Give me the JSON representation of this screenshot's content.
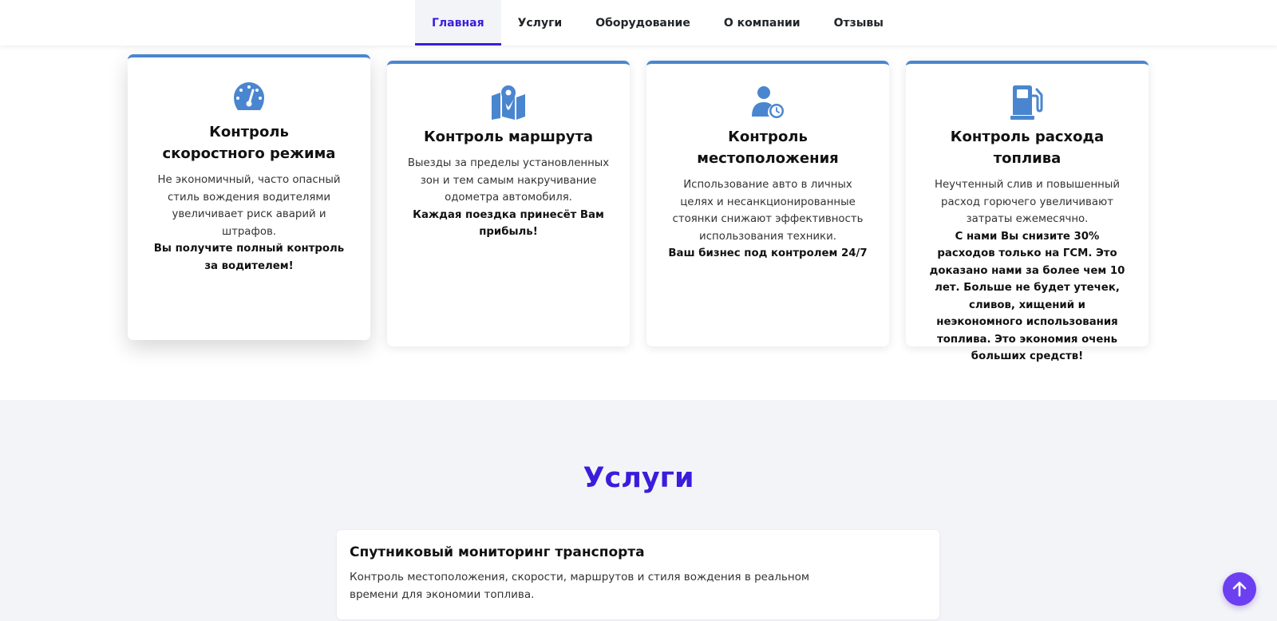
{
  "nav": {
    "items": [
      {
        "label": "Главная",
        "active": true
      },
      {
        "label": "Услуги",
        "active": false
      },
      {
        "label": "Оборудование",
        "active": false
      },
      {
        "label": "О компании",
        "active": false
      },
      {
        "label": "Отзывы",
        "active": false
      }
    ]
  },
  "features": [
    {
      "icon": "speedometer-icon",
      "title": "Контроль скоростного режима",
      "text": "Не экономичный, часто опасный стиль вождения водителями увеличивает риск аварий и штрафов.",
      "strong": "Вы получите полный контроль за водителем!"
    },
    {
      "icon": "map-pin-icon",
      "title": "Контроль маршрута",
      "text": "Выезды за пределы установленных зон и тем самым накручивание одометра автомобиля.",
      "strong": "Каждая поездка принесёт Вам прибыль!"
    },
    {
      "icon": "user-clock-icon",
      "title": "Контроль местоположения",
      "text": "Использование авто в личных целях и несанкционированные стоянки снижают эффективность использования техники.",
      "strong": "Ваш бизнес под контролем 24/7"
    },
    {
      "icon": "gas-pump-icon",
      "title": "Контроль расхода топлива",
      "text": "Неучтенный слив и повышенный расход горючего увеличивают затраты ежемесячно.",
      "strong": "С нами Вы снизите 30% расходов только на ГСМ. Это доказано нами за более чем 10 лет. Больше не будет утечек, сливов, хищений и неэкономного использования топлива. Это экономия очень больших средств!"
    }
  ],
  "services": {
    "heading": "Услуги",
    "items": [
      {
        "title": "Спутниковый мониторинг транспорта",
        "desc": "Контроль местоположения, скорости, маршрутов и стиля вождения в реальном времени для экономии топлива."
      }
    ]
  },
  "colors": {
    "accent": "#3a1ddb",
    "icon": "#4a86cf",
    "card_border": "#4a86cf",
    "to_top": "#6c3ff0"
  },
  "to_top": {
    "icon": "arrow-up-icon"
  }
}
